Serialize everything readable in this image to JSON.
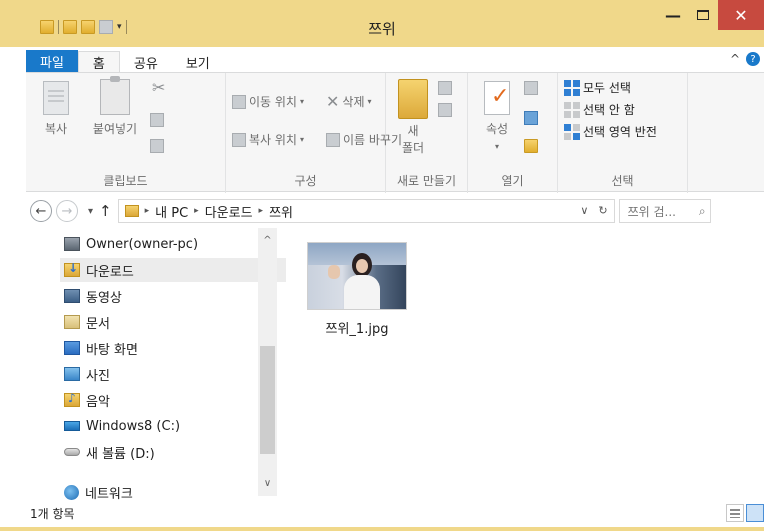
{
  "window": {
    "title": "쯔위",
    "minimize": "—",
    "close": "✕"
  },
  "colors": {
    "titlebar": "#f0d88a",
    "file_tab": "#1979ca",
    "close_button": "#c74a3f",
    "selected_nav": "#ececec"
  },
  "qat": {
    "dropdown_arrow": "▾"
  },
  "ribbon": {
    "tabs": [
      {
        "label": "파일"
      },
      {
        "label": "홈"
      },
      {
        "label": "공유"
      },
      {
        "label": "보기"
      }
    ],
    "collapse_icon": "^",
    "help_icon": "?",
    "clipboard": {
      "copy": "복사",
      "paste": "붙여넣기",
      "label": "클립보드"
    },
    "organize": {
      "move_to": "이동 위치",
      "copy_to": "복사 위치",
      "delete": "삭제",
      "rename": "이름 바꾸기",
      "dropdown": "▾",
      "label": "구성"
    },
    "new": {
      "new_folder_line1": "새",
      "new_folder_line2": "폴더",
      "label": "새로 만들기"
    },
    "open": {
      "properties": "속성",
      "dropdown": "▾",
      "label": "열기"
    },
    "select": {
      "select_all": "모두 선택",
      "select_none": "선택 안 함",
      "invert_selection": "선택 영역 반전",
      "label": "선택"
    }
  },
  "address": {
    "back_icon": "←",
    "forward_icon": "→",
    "recent_icon": "▾",
    "up_icon": "↑",
    "crumb_sep": "▸",
    "crumbs": [
      "내 PC",
      "다운로드",
      "쯔위"
    ],
    "dropdown_icon": "∨",
    "refresh_icon": "↻",
    "search_placeholder": "쯔위 검...",
    "search_icon": "⌕"
  },
  "navigation": {
    "items": [
      {
        "label": "Owner(owner-pc)",
        "icon": "user-icon"
      },
      {
        "label": "다운로드",
        "icon": "downloads-folder-icon",
        "selected": true
      },
      {
        "label": "동영상",
        "icon": "videos-folder-icon"
      },
      {
        "label": "문서",
        "icon": "documents-folder-icon"
      },
      {
        "label": "바탕 화면",
        "icon": "desktop-folder-icon"
      },
      {
        "label": "사진",
        "icon": "pictures-folder-icon"
      },
      {
        "label": "음악",
        "icon": "music-folder-icon"
      },
      {
        "label": "Windows8 (C:)",
        "icon": "drive-c-icon"
      },
      {
        "label": "새 볼륨 (D:)",
        "icon": "drive-d-icon"
      },
      {
        "label": "네트워크",
        "icon": "network-icon"
      }
    ],
    "scroll_up": "^",
    "scroll_down": "∨"
  },
  "content": {
    "files": [
      {
        "name": "쯔위_1.jpg",
        "type": "image"
      }
    ]
  },
  "status": {
    "item_count": "1개 항목"
  }
}
